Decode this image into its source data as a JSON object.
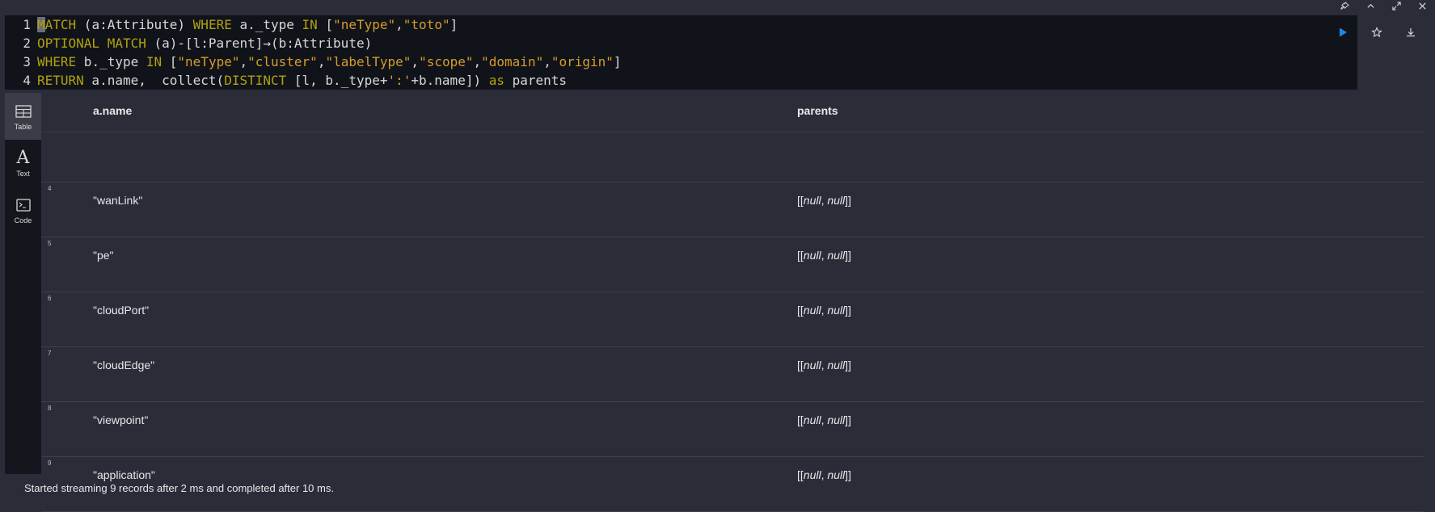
{
  "editor": {
    "lines": [
      {
        "num": "1"
      },
      {
        "num": "2"
      },
      {
        "num": "3"
      },
      {
        "num": "4"
      }
    ]
  },
  "views": [
    {
      "label": "Table",
      "icon": "table-icon"
    },
    {
      "label": "Text",
      "icon": "text-icon"
    },
    {
      "label": "Code",
      "icon": "code-icon"
    }
  ],
  "table": {
    "headers": {
      "name": "a.name",
      "parents": "parents"
    },
    "rows": [
      {
        "num": "4",
        "name": "\"wanLink\""
      },
      {
        "num": "5",
        "name": "\"pe\""
      },
      {
        "num": "6",
        "name": "\"cloudPort\""
      },
      {
        "num": "7",
        "name": "\"cloudEdge\""
      },
      {
        "num": "8",
        "name": "\"viewpoint\""
      },
      {
        "num": "9",
        "name": "\"application\""
      }
    ],
    "parents_value": {
      "open": "[[",
      "a": "null",
      ", ": ", ",
      "b": "null",
      "close": "]]"
    }
  },
  "status": "Started streaming 9 records after 2 ms and completed after 10 ms.",
  "colors": {
    "accent": "#1e88e5",
    "keyword": "#b1a10e",
    "string": "#d69d2a",
    "background": "#2a2d38"
  }
}
